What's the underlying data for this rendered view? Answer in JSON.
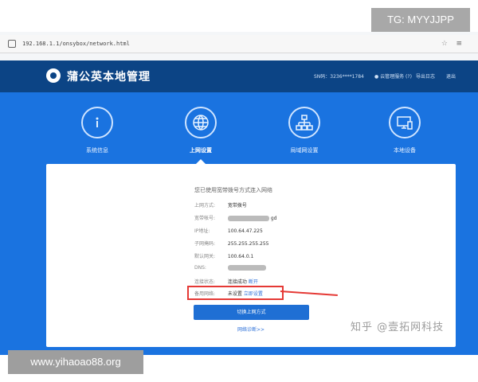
{
  "overlay": {
    "tg_badge": "TG: MYYJJPP",
    "site": "www.yihaoao88.org",
    "watermark": "知乎 @壹拓网科技"
  },
  "browser": {
    "address": "192.168.1.1/onsybox/network.html"
  },
  "header": {
    "brand": "蒲公英本地管理",
    "sn": "SN码：3236****1784",
    "cloud": "● 云管理服务 (?)",
    "export_log": "导出日志",
    "logout": "退出"
  },
  "tabs": [
    {
      "label": "系统信息",
      "icon": "info-icon"
    },
    {
      "label": "上网设置",
      "icon": "globe-icon",
      "active": true
    },
    {
      "label": "局域网设置",
      "icon": "lan-tree-icon"
    },
    {
      "label": "本地设备",
      "icon": "device-icon"
    }
  ],
  "panel": {
    "intro": "您已使用宽带拨号方式连入网络",
    "rows": [
      {
        "key": "上网方式:",
        "value": "宽带拨号"
      },
      {
        "key": "宽带帐号:",
        "value": "gd"
      },
      {
        "key": "IP地址:",
        "value": "100.64.47.225"
      },
      {
        "key": "子网掩码:",
        "value": "255.255.255.255"
      },
      {
        "key": "默认网关:",
        "value": "100.64.0.1"
      },
      {
        "key": "DNS:",
        "value": ""
      },
      {
        "key": "连接状态:",
        "value": "连接成功",
        "extra": "断开"
      },
      {
        "key": "备用网络:",
        "value": "未设置",
        "extra": "立即设置"
      }
    ],
    "switch_button": "切换上网方式",
    "diagnose_link": "网络诊断>>"
  },
  "colors": {
    "header_bg": "#0c4485",
    "hero_bg": "#1a73e0",
    "button_bg": "#1f6fd4",
    "highlight": "#e53935"
  }
}
